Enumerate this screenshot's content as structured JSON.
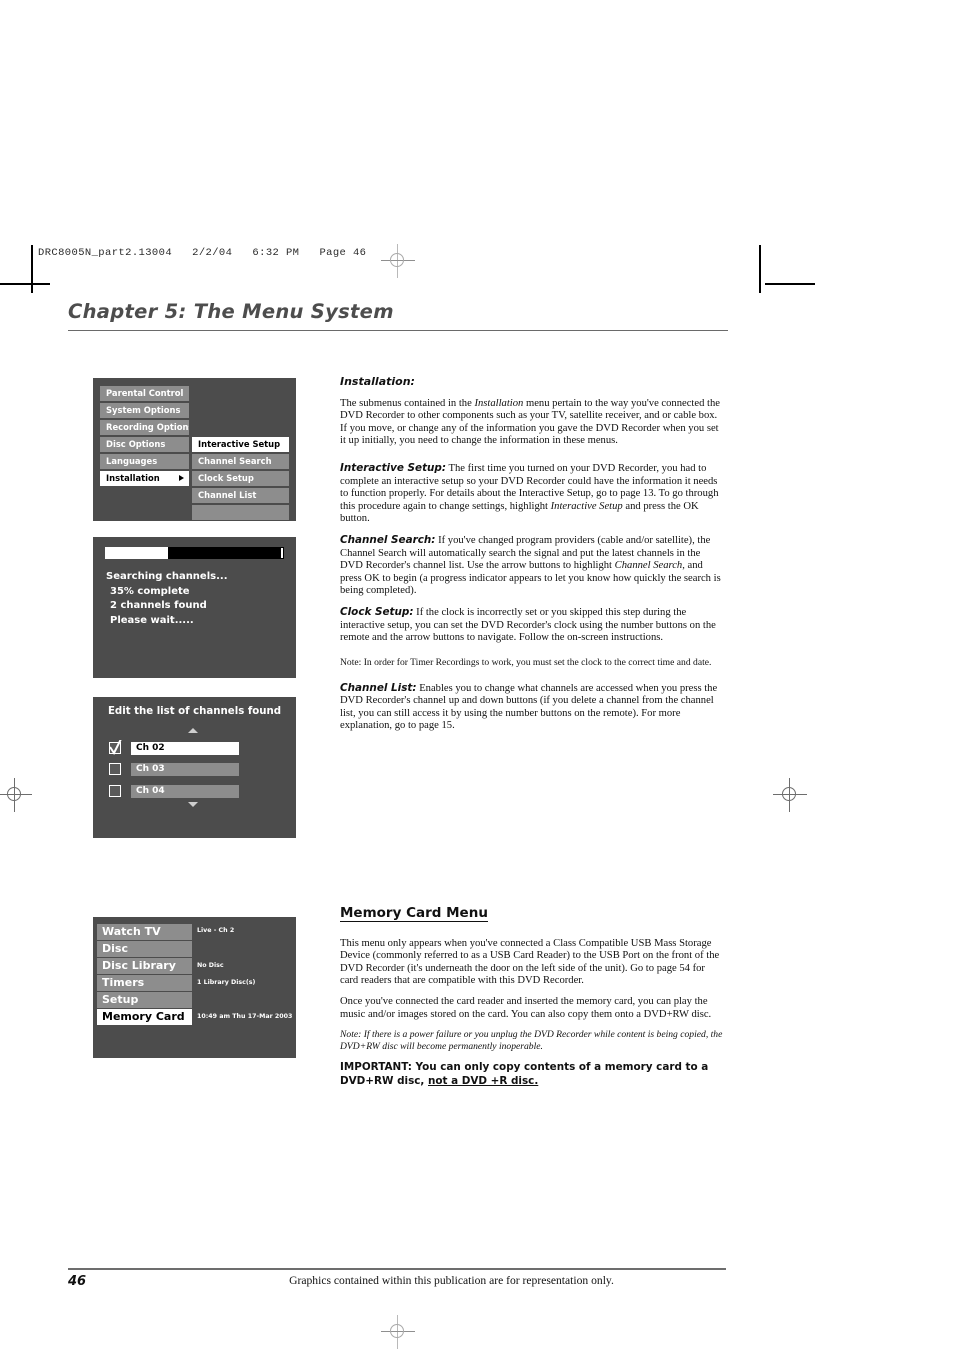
{
  "page": {
    "slug": "DRC8005N_part2.13004   2/2/04   6:32 PM   Page 46",
    "chapter_title": "Chapter 5: The Menu System",
    "folio": "46",
    "footer_text": "Graphics contained within this publication are for representation only."
  },
  "osd_setup_menu": {
    "main_items": [
      {
        "label": "Parental Control",
        "selected": false
      },
      {
        "label": "System Options",
        "selected": false
      },
      {
        "label": "Recording Options",
        "selected": false
      },
      {
        "label": "Disc Options",
        "selected": false
      },
      {
        "label": "Languages",
        "selected": false
      },
      {
        "label": "Installation",
        "selected": true,
        "arrow": true
      }
    ],
    "submenu_items": [
      {
        "label": "Interactive Setup",
        "selected": true
      },
      {
        "label": "Channel Search",
        "selected": false
      },
      {
        "label": "Clock Setup",
        "selected": false
      },
      {
        "label": "Channel List",
        "selected": false
      },
      {
        "label": "",
        "selected": false
      }
    ]
  },
  "osd_channel_search": {
    "progress_percent": 35,
    "progress_label": "35% complete",
    "line_1": "Searching channels...",
    "line_2": "35% complete",
    "line_3": "2 channels found",
    "line_4": "Please wait....."
  },
  "osd_channel_list": {
    "title": "Edit the list of channels found",
    "scroll_up_icon": "triangle-up-icon",
    "scroll_down_icon": "triangle-down-icon",
    "rows": [
      {
        "label": "Ch 02",
        "checked": true,
        "selected": true
      },
      {
        "label": "Ch 03",
        "checked": false,
        "selected": false
      },
      {
        "label": "Ch 04",
        "checked": false,
        "selected": false
      }
    ]
  },
  "osd_main_menu": {
    "rows": [
      {
        "label": "Watch TV",
        "selected": false,
        "info": "Live - Ch 2"
      },
      {
        "label": "Disc",
        "selected": false,
        "info": ""
      },
      {
        "label": "Disc Library",
        "selected": false,
        "info": "No Disc"
      },
      {
        "label": "Timers",
        "selected": false,
        "info": "1 Library Disc(s)"
      },
      {
        "label": "Setup",
        "selected": false,
        "info": ""
      },
      {
        "label": "Memory Card",
        "selected": true,
        "info": "10:49 am Thu 17-Mar 2003"
      }
    ]
  },
  "installation": {
    "heading": "Installation:",
    "intro_a": " The submenus contained in the ",
    "intro_italic": "Installation",
    "intro_b": " menu pertain to the way you've connected the DVD Recorder to other components such as your TV, satellite receiver, and or cable box. If you move, or change any of the information you gave the DVD Recorder when you set it up initially, you need to change the information in these menus.",
    "interactive_setup_head": "Interactive Setup:",
    "interactive_setup_a": " The first time you turned on your DVD Recorder, you had to complete an interactive setup so your DVD Recorder could have the information it needs to function properly. For details about the Interactive Setup, go to page 13. To go through this procedure again to change settings, highlight ",
    "interactive_setup_italic": "Interactive Setup",
    "interactive_setup_b": " and press the OK button.",
    "channel_search_head": "Channel Search:",
    "channel_search_a": " If you've changed program providers (cable and/or satellite), the Channel Search will automatically search the signal and put the latest channels in the DVD Recorder's channel list. Use the arrow buttons to highlight ",
    "channel_search_italic": "Channel Search",
    "channel_search_b": ", and press OK to begin (a progress indicator appears to let you know how quickly the search is being completed).",
    "clock_setup_head": "Clock Setup:",
    "clock_setup_body": " If the clock is incorrectly set or you skipped this step during the interactive setup, you can set the DVD Recorder's clock using the number buttons on the remote and the arrow buttons to navigate. Follow the on-screen instructions.",
    "clock_note": "Note: In order for Timer Recordings to work, you must set the clock to the correct time and date.",
    "channel_list_head": "Channel List:",
    "channel_list_body": " Enables you to change what channels are accessed when you press the DVD Recorder's channel up and down buttons (if you delete a channel from the channel list, you can still access it by using the number buttons on the remote). For more explanation, go to page 15."
  },
  "memory_card": {
    "heading": "Memory Card Menu",
    "para_1": "This menu only appears when you've connected a Class Compatible USB Mass Storage Device (commonly referred to as a USB Card Reader) to the USB Port on the front of the DVD Recorder (it's underneath the door on the left side of the unit). Go to page 54 for card readers that are compatible with this DVD Recorder.",
    "para_2": "Once you've connected the card reader and inserted the memory card, you can play the music and/or images stored on the card. You can also copy them onto a DVD+RW disc.",
    "note": "Note: If there is a power failure or you unplug the DVD Recorder while content is being copied, the DVD+RW disc will become permanently inoperable.",
    "important_a": "IMPORTANT: You can only copy contents of a memory card to a DVD+RW disc, ",
    "important_underlined": "not a DVD +R disc."
  },
  "colors": {
    "osd_panel": "#4c4c4c",
    "osd_row": "#8d8d8d",
    "osd_row_selected": "#ffffff",
    "chapter_title": "#4d4d4d",
    "rule": "#6d6d6d"
  }
}
